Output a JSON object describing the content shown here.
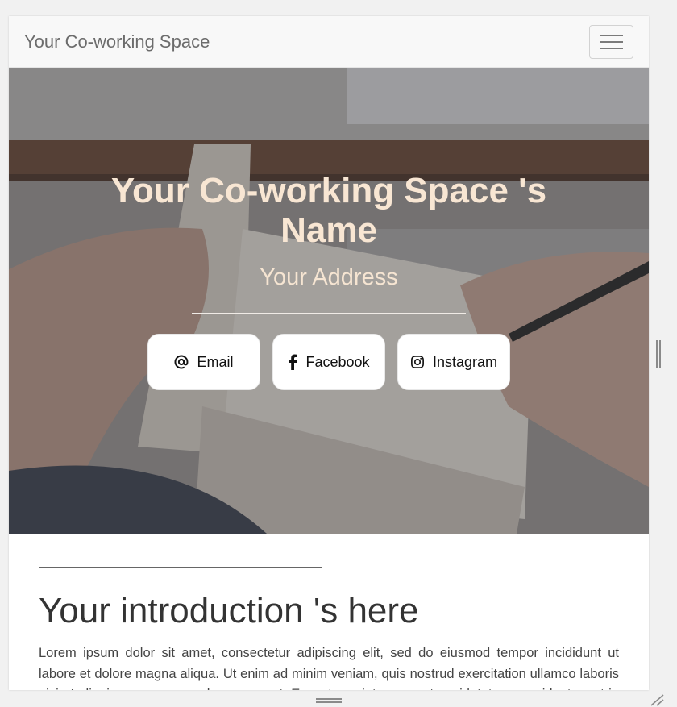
{
  "navbar": {
    "brand": "Your Co-working Space"
  },
  "hero": {
    "title": "Your Co-working Space 's Name",
    "subtitle": "Your Address",
    "social": [
      {
        "label": "Email",
        "icon": "at-icon"
      },
      {
        "label": "Facebook",
        "icon": "facebook-icon"
      },
      {
        "label": "Instagram",
        "icon": "instagram-icon"
      }
    ]
  },
  "intro": {
    "title": "Your introduction 's here",
    "text": "Lorem ipsum dolor sit amet, consectetur adipiscing elit, sed do eiusmod tempor incididunt ut labore et dolore magna aliqua. Ut enim ad minim veniam, quis nostrud exercitation ullamco laboris nisi ut aliquip ex ea commodo consequat. Excepteur sint occaecat cupidatat non proident, sunt in culpa qui officia deserunt mollit anim id est laborum."
  },
  "colors": {
    "hero_text": "#f8e6d3",
    "navbar_bg": "#f8f8f8",
    "brand_text": "#6c6c6c"
  }
}
